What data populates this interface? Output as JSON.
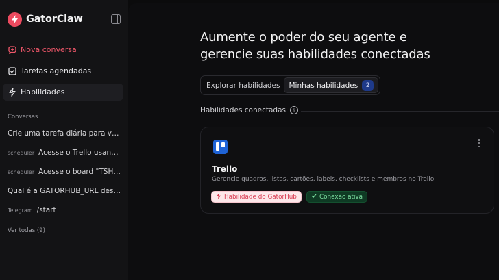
{
  "app": {
    "name": "GatorClaw"
  },
  "sidebar": {
    "new_chat": "Nova conversa",
    "scheduled_tasks": "Tarefas agendadas",
    "skills": "Habilidades",
    "conversations_label": "Conversas",
    "conversations": [
      {
        "tag": "",
        "text": "Crie uma tarefa diária para ver..."
      },
      {
        "tag": "scheduler",
        "text": "Acesse o Trello usand..."
      },
      {
        "tag": "scheduler",
        "text": "Acesse o board \"TSHS..."
      },
      {
        "tag": "",
        "text": "Qual é a GATORHUB_URL dest..."
      },
      {
        "tag": "Telegram",
        "text": "/start"
      }
    ],
    "see_all": "Ver todas (9)"
  },
  "main": {
    "title_line1": "Aumente o poder do seu agente e",
    "title_line2": "gerencie suas habilidades conectadas",
    "tabs": [
      {
        "label": "Explorar habilidades"
      },
      {
        "label": "Minhas habilidades",
        "count": "2"
      }
    ],
    "connected_label": "Habilidades conectadas",
    "card": {
      "title": "Trello",
      "description": "Gerencie quadros, listas, cartões, labels, checklists e membros no Trello.",
      "badge_source": "Habilidade do GatorHub",
      "badge_status": "Conexão ativa"
    }
  },
  "colors": {
    "accent": "#ec4a5f",
    "trello_blue": "#1f63d6",
    "success": "#7ee0a3"
  }
}
